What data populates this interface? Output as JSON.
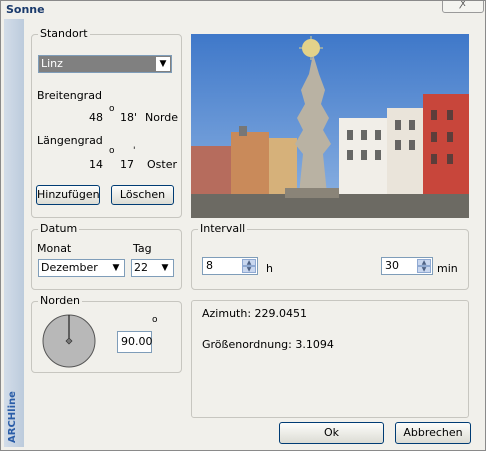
{
  "window": {
    "title": "Sonne",
    "close_glyph": "ꭗ",
    "side_label": "ARCHline"
  },
  "standort": {
    "legend": "Standort",
    "location": "Linz",
    "breitengrad_label": "Breitengrad",
    "breitengrad_deg": "48",
    "breitengrad_min": "18'",
    "breitengrad_dir": "Norde",
    "laengengrad_label": "Längengrad",
    "laengengrad_deg": "14",
    "laengengrad_min": "17",
    "laengengrad_dir": "Oster",
    "degree_glyph": "o",
    "minute_glyph": "'",
    "add_label": "Hinzufügen",
    "delete_label": "Löschen"
  },
  "datum": {
    "legend": "Datum",
    "monat_label": "Monat",
    "tag_label": "Tag",
    "monat": "Dezember",
    "tag": "22"
  },
  "intervall": {
    "legend": "Intervall",
    "hours": "8",
    "hours_unit": "h",
    "minutes": "30",
    "minutes_unit": "min"
  },
  "norden": {
    "legend": "Norden",
    "value": "90.00",
    "degree_glyph": "o",
    "angle": 90
  },
  "info": {
    "azimuth": "Azimuth: 229.0451",
    "magnitude": "Größenordnung: 3.1094"
  },
  "buttons": {
    "ok": "Ok",
    "cancel": "Abbrechen"
  },
  "icons": {
    "dropdown": "▼",
    "spin_up": "▲",
    "spin_down": "▼"
  }
}
